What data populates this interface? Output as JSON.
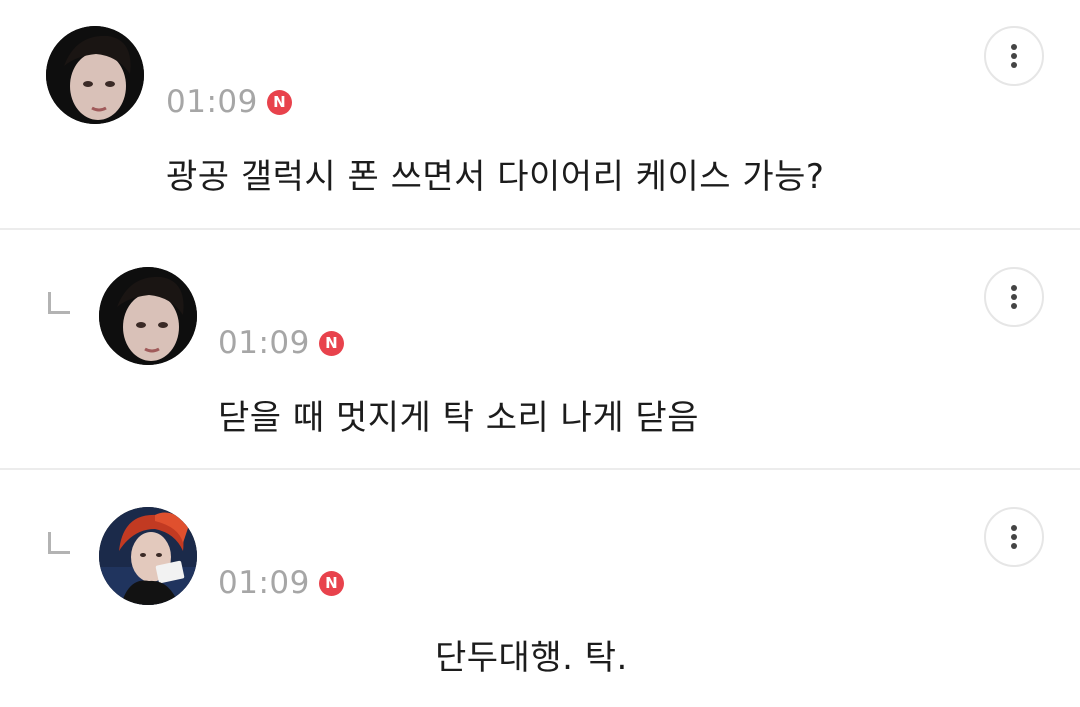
{
  "comments": [
    {
      "time": "01:09",
      "badge": "N",
      "text": "광공 갤럭시 폰 쓰면서 다이어리 케이스 가능?",
      "is_reply": false,
      "avatar_icon": "profile-photo-dark"
    },
    {
      "time": "01:09",
      "badge": "N",
      "text": "닫을 때 멋지게 탁 소리 나게 닫음",
      "is_reply": true,
      "avatar_icon": "profile-photo-dark"
    },
    {
      "time": "01:09",
      "badge": "N",
      "text": "단두대행. 탁.",
      "is_reply": true,
      "avatar_icon": "profile-photo-red-hair"
    }
  ],
  "colors": {
    "badge": "#e8424c",
    "time": "#a6a6a6",
    "text": "#1c1c1c",
    "divider": "#ececec"
  },
  "icons": {
    "more": "more-vertical-icon",
    "reply": "reply-arrow-icon"
  }
}
